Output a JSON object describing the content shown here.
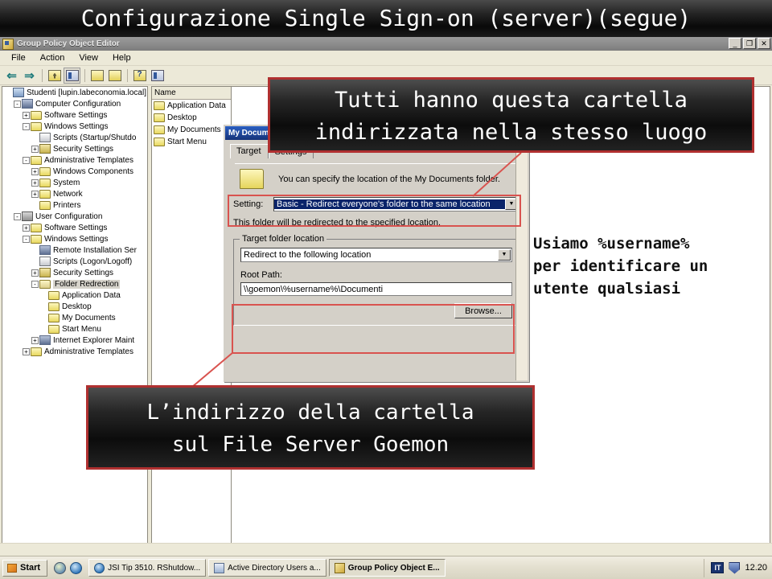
{
  "slide": {
    "title": "Configurazione Single Sign-on (server)(segue)"
  },
  "callouts": {
    "top": {
      "line1": "Tutti hanno questa cartella",
      "line2": "indirizzata nella stesso luogo"
    },
    "bottom": {
      "line1": "L’indirizzo della cartella",
      "line2": "sul File Server Goemon"
    },
    "right_note": {
      "line1": "Usiamo %username%",
      "line2": "per identificare un",
      "line3": "utente qualsiasi"
    },
    "border_color": "#b03030",
    "highlight_color": "#d9534f"
  },
  "window": {
    "title": "Group Policy Object Editor",
    "title_icon": "console-icon",
    "controls": {
      "minimize": "_",
      "restore": "❐",
      "close": "✕"
    },
    "menu": [
      "File",
      "Action",
      "View",
      "Help"
    ],
    "toolbar": [
      {
        "name": "back-button",
        "glyph": "⇐"
      },
      {
        "name": "forward-button",
        "glyph": "⇒"
      },
      {
        "name": "up-one-level-button",
        "glyph": ""
      },
      {
        "name": "show-hide-tree-button",
        "glyph": ""
      },
      {
        "name": "properties-button",
        "glyph": ""
      },
      {
        "name": "export-list-button",
        "glyph": ""
      },
      {
        "name": "help-button",
        "glyph": ""
      },
      {
        "name": "new-window-button",
        "glyph": ""
      }
    ]
  },
  "tree": {
    "items": [
      {
        "label": "Studenti [lupin.labeconomia.local] P",
        "indent": 0,
        "toggle": "",
        "icon": "policy-root-icon",
        "selected": false
      },
      {
        "label": "Computer Configuration",
        "indent": 1,
        "toggle": "-",
        "icon": "computer-icon",
        "selected": false
      },
      {
        "label": "Software Settings",
        "indent": 2,
        "toggle": "+",
        "icon": "folder-icon",
        "selected": false
      },
      {
        "label": "Windows Settings",
        "indent": 2,
        "toggle": "-",
        "icon": "folder-icon",
        "selected": false
      },
      {
        "label": "Scripts (Startup/Shutdo",
        "indent": 3,
        "toggle": "",
        "icon": "script-icon",
        "selected": false
      },
      {
        "label": "Security Settings",
        "indent": 3,
        "toggle": "+",
        "icon": "security-icon",
        "selected": false
      },
      {
        "label": "Administrative Templates",
        "indent": 2,
        "toggle": "-",
        "icon": "folder-icon",
        "selected": false
      },
      {
        "label": "Windows Components",
        "indent": 3,
        "toggle": "+",
        "icon": "folder-icon",
        "selected": false
      },
      {
        "label": "System",
        "indent": 3,
        "toggle": "+",
        "icon": "folder-icon",
        "selected": false
      },
      {
        "label": "Network",
        "indent": 3,
        "toggle": "+",
        "icon": "folder-icon",
        "selected": false
      },
      {
        "label": "Printers",
        "indent": 3,
        "toggle": "",
        "icon": "folder-icon",
        "selected": false
      },
      {
        "label": "User Configuration",
        "indent": 1,
        "toggle": "-",
        "icon": "user-icon",
        "selected": false
      },
      {
        "label": "Software Settings",
        "indent": 2,
        "toggle": "+",
        "icon": "folder-icon",
        "selected": false
      },
      {
        "label": "Windows Settings",
        "indent": 2,
        "toggle": "-",
        "icon": "folder-icon",
        "selected": false
      },
      {
        "label": "Remote Installation Ser",
        "indent": 3,
        "toggle": "",
        "icon": "remote-install-icon",
        "selected": false
      },
      {
        "label": "Scripts (Logon/Logoff)",
        "indent": 3,
        "toggle": "",
        "icon": "script-icon",
        "selected": false
      },
      {
        "label": "Security Settings",
        "indent": 3,
        "toggle": "+",
        "icon": "security-icon",
        "selected": false
      },
      {
        "label": "Folder Redrection",
        "indent": 3,
        "toggle": "-",
        "icon": "folder-open-icon",
        "selected": true
      },
      {
        "label": "Application Data",
        "indent": 4,
        "toggle": "",
        "icon": "folder-icon",
        "selected": false
      },
      {
        "label": "Desktop",
        "indent": 4,
        "toggle": "",
        "icon": "folder-icon",
        "selected": false
      },
      {
        "label": "My Documents",
        "indent": 4,
        "toggle": "",
        "icon": "folder-icon",
        "selected": false
      },
      {
        "label": "Start Menu",
        "indent": 4,
        "toggle": "",
        "icon": "folder-icon",
        "selected": false
      },
      {
        "label": "Internet Explorer Maint",
        "indent": 3,
        "toggle": "+",
        "icon": "ie-maint-icon",
        "selected": false
      },
      {
        "label": "Administrative Templates",
        "indent": 2,
        "toggle": "+",
        "icon": "folder-icon",
        "selected": false
      }
    ]
  },
  "list": {
    "column_header": "Name",
    "rows": [
      "Application Data",
      "Desktop",
      "My Documents",
      "Start Menu"
    ]
  },
  "dialog": {
    "title": "My Docume",
    "tabs": [
      {
        "label": "Target",
        "active": true
      },
      {
        "label": "Settings",
        "active": false
      }
    ],
    "description": "You can specify the location of the My Documents folder.",
    "setting_label": "Setting:",
    "setting_value": "Basic - Redirect everyone's folder to the same location",
    "hint_text": "This folder will be redirected to the specified location.",
    "group_title": "Target folder location",
    "location_value": "Redirect to the following location",
    "root_path_label": "Root Path:",
    "root_path_value": "\\\\goemon\\%username%\\Documenti",
    "browse_label": "Browse..."
  },
  "taskbar": {
    "start_label": "Start",
    "quick_launch": [
      "media-player-icon",
      "internet-explorer-icon"
    ],
    "buttons": [
      {
        "label": "JSI Tip 3510. RShutdow...",
        "icon": "internet-explorer-icon",
        "active": false
      },
      {
        "label": "Active Directory Users a...",
        "icon": "active-directory-icon",
        "active": false
      },
      {
        "label": "Group Policy Object E...",
        "icon": "console-icon",
        "active": true
      }
    ],
    "tray": {
      "language": "IT",
      "shield_icon": "security-shield-icon",
      "time": "12.20"
    }
  }
}
